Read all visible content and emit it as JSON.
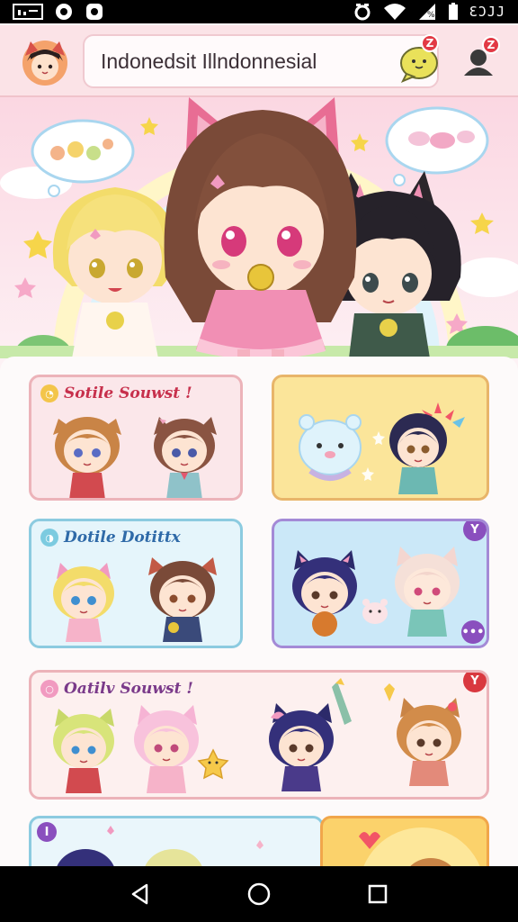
{
  "status_bar": {
    "time": "ƐƆJJ",
    "icons": [
      "screenshot-icon",
      "circle-icon",
      "notification-icon",
      "alarm-icon",
      "wifi-icon",
      "cell-signal-icon",
      "battery-icon"
    ]
  },
  "header": {
    "search_text": "Indonedsit Illndonnesial",
    "chat_badge": "Z",
    "user_badge": "Z"
  },
  "cards": [
    {
      "title": "Sotile Souwst !",
      "border": "#ecb3b9",
      "bg": "#fbe7ea",
      "title_color": "#c7304c",
      "dot_color": "#f3c54a"
    },
    {
      "title": "",
      "border": "#e8b56a",
      "bg": "#fbe59a"
    },
    {
      "title": "Dotile Dotittx",
      "border": "#8ccbe0",
      "bg": "#e5f5fb",
      "title_color": "#2f6aa8",
      "dot_color": "#7ccbe0"
    },
    {
      "title": "",
      "border": "#a48ad6",
      "bg": "#cbe8f8",
      "badge": "Y",
      "badge_color": "#8a4fbe"
    },
    {
      "title": "Oatilv Souwst !",
      "border": "#ecb3b9",
      "bg": "#fdf0ef",
      "title_color": "#7a3a8a",
      "dot_color": "#f19ac0",
      "badge": "Y",
      "badge_color": "#d9383f"
    },
    {
      "title": "",
      "border": "#8ccbe0",
      "bg": "#eaf6fb",
      "badge": "I",
      "badge_color": "#8a4fbe"
    },
    {
      "title": "",
      "border": "#f1a64a",
      "bg": "#fbd26b"
    }
  ],
  "nav": {
    "back": "back-icon",
    "home": "home-icon",
    "recents": "recents-icon"
  }
}
